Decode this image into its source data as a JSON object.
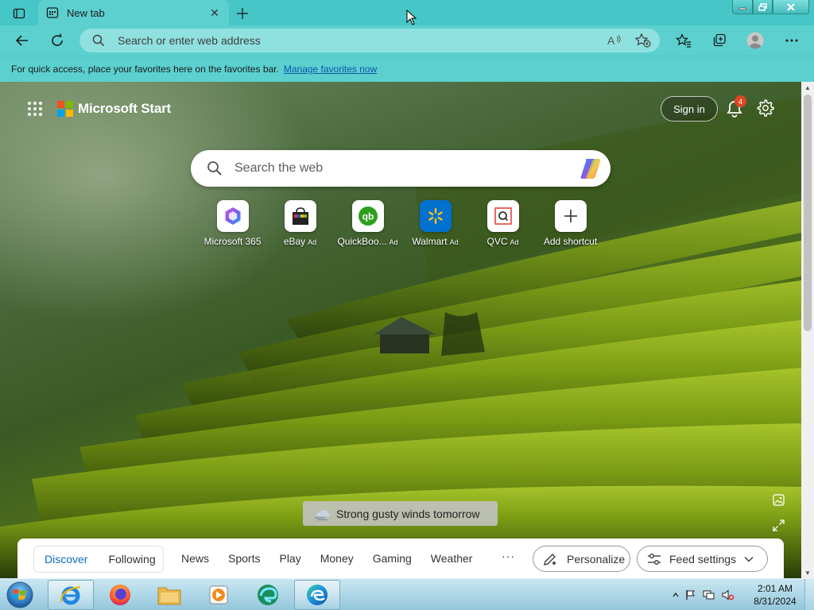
{
  "browser": {
    "tab_title": "New tab",
    "address_placeholder": "Search or enter web address",
    "favorites_bar": {
      "message": "For quick access, place your favorites here on the favorites bar.",
      "link": "Manage favorites now"
    }
  },
  "start_page": {
    "brand": "Microsoft Start",
    "sign_in": "Sign in",
    "notification_count": "4",
    "search_placeholder": "Search the web",
    "shortcuts": [
      {
        "label": "Microsoft 365",
        "ad": "",
        "icon": "microsoft-365-icon"
      },
      {
        "label": "eBay",
        "ad": "Ad",
        "icon": "ebay-icon"
      },
      {
        "label": "QuickBoo...",
        "ad": "Ad",
        "icon": "quickbooks-icon"
      },
      {
        "label": "Walmart",
        "ad": "Ad",
        "icon": "walmart-icon"
      },
      {
        "label": "QVC",
        "ad": "Ad",
        "icon": "qvc-icon"
      },
      {
        "label": "Add shortcut",
        "ad": "",
        "icon": "plus-icon"
      }
    ],
    "weather_text": "Strong gusty winds tomorrow",
    "feed": {
      "segments": [
        "Discover",
        "Following"
      ],
      "active_segment": "Discover",
      "tabs": [
        "News",
        "Sports",
        "Play",
        "Money",
        "Gaming",
        "Weather"
      ],
      "more": "···",
      "personalize": "Personalize",
      "feed_settings": "Feed settings"
    }
  },
  "taskbar": {
    "time": "2:01 AM",
    "date": "8/31/2024",
    "pinned": [
      "internet-explorer-icon",
      "firefox-icon",
      "file-explorer-icon",
      "media-player-icon",
      "edge-dev-icon",
      "edge-icon"
    ],
    "active": "edge-icon"
  },
  "colors": {
    "browser_chrome": "#5bd0cf",
    "title_bar": "#46c6c6",
    "link": "#1155aa",
    "active_segment": "#0f6cbd",
    "notification_badge": "#e0451f"
  }
}
